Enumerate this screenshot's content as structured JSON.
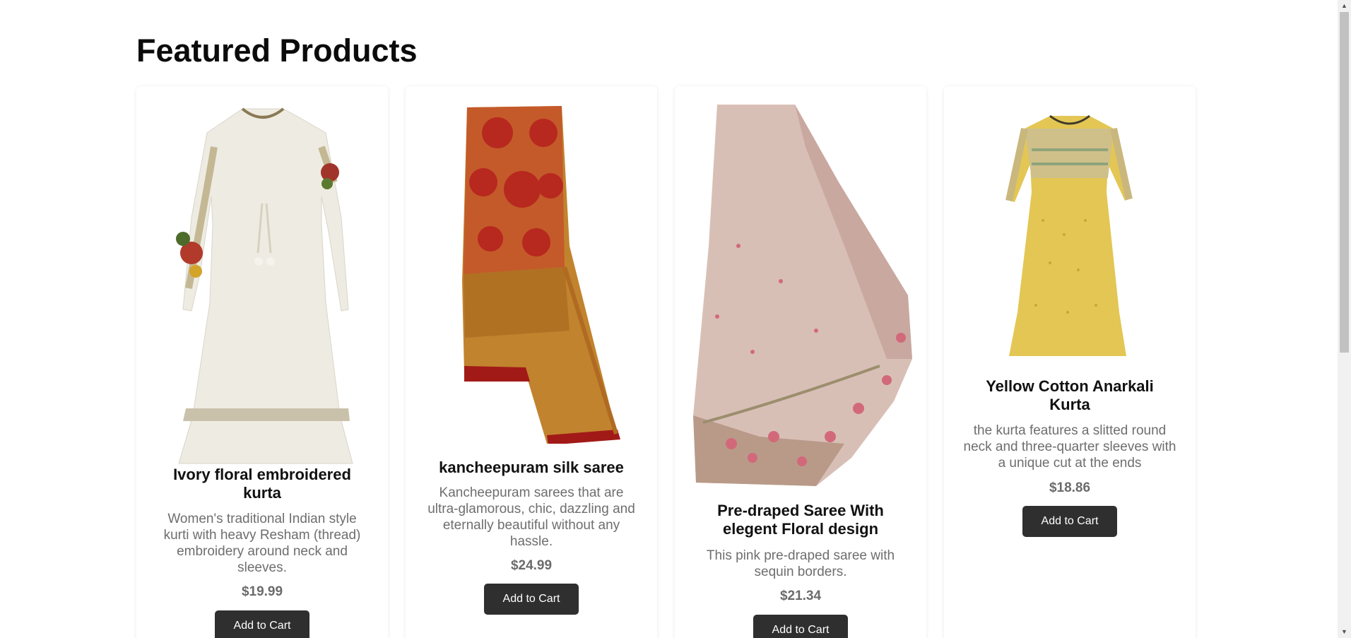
{
  "page": {
    "title": "Featured Products"
  },
  "products": [
    {
      "name": "Ivory floral embroidered kurta",
      "description": "Women's traditional Indian style kurti with heavy Resham (thread) embroidery around neck and sleeves.",
      "price": "$19.99",
      "button": "Add to Cart",
      "image": "ivory-kurta-image"
    },
    {
      "name": "kancheepuram silk saree",
      "description": "Kancheepuram sarees that are ultra-glamorous, chic, dazzling and eternally beautiful without any hassle.",
      "price": "$24.99",
      "button": "Add to Cart",
      "image": "silk-saree-image"
    },
    {
      "name": "Pre-draped Saree With elegent Floral design",
      "description": "This pink pre-draped saree with sequin borders.",
      "price": "$21.34",
      "button": "Add to Cart",
      "image": "pink-saree-image"
    },
    {
      "name": "Yellow Cotton Anarkali Kurta",
      "description": "the kurta features a slitted round neck and three-quarter sleeves with a unique cut at the ends",
      "price": "$18.86",
      "button": "Add to Cart",
      "image": "yellow-kurta-image"
    }
  ],
  "colors": {
    "button_bg": "#2f2f2f",
    "price": "#6b6b6b",
    "desc": "#6e6e6e"
  }
}
